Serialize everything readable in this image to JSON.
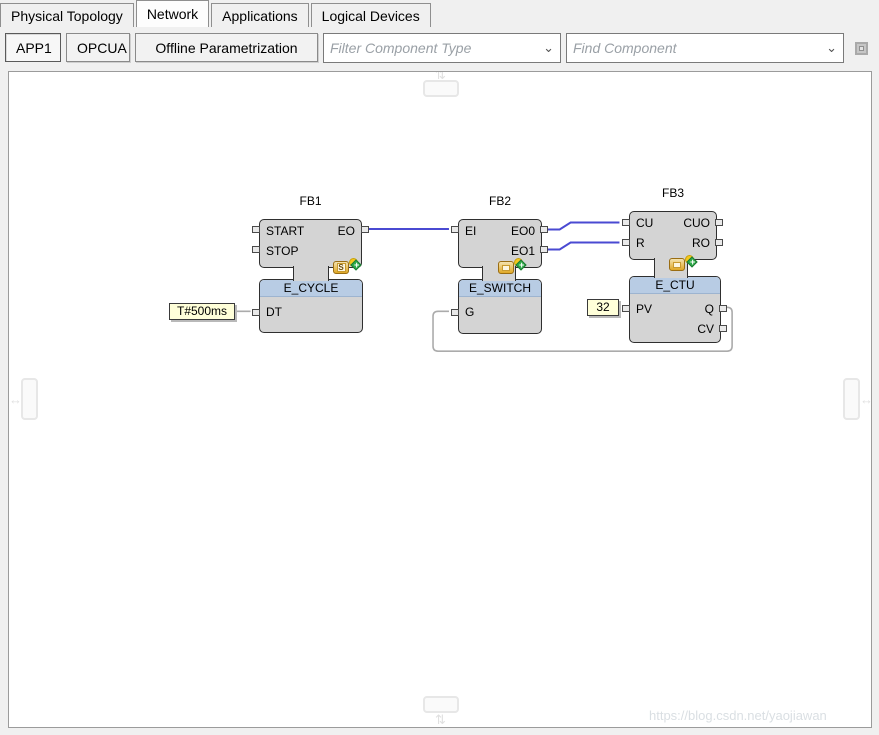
{
  "tabs": [
    {
      "label": "Physical Topology",
      "active": false
    },
    {
      "label": "Network",
      "active": true
    },
    {
      "label": "Applications",
      "active": false
    },
    {
      "label": "Logical Devices",
      "active": false
    }
  ],
  "toolbar": {
    "buttons": [
      {
        "label": "APP1",
        "pressed": true
      },
      {
        "label": "OPCUA",
        "pressed": false
      },
      {
        "label": "Offline Parametrization",
        "pressed": false
      }
    ],
    "filter_combo": {
      "placeholder": "Filter Component Type"
    },
    "find_combo": {
      "placeholder": "Find Component"
    }
  },
  "diagram": {
    "blocks": [
      {
        "name": "FB1",
        "type": "E_CYCLE",
        "kind_icon": "sifb-s-chip-icon",
        "event_inputs": [
          "START",
          "STOP"
        ],
        "event_outputs": [
          "EO"
        ],
        "data_inputs": [
          {
            "name": "DT",
            "value": "T#500ms"
          }
        ],
        "data_outputs": []
      },
      {
        "name": "FB2",
        "type": "E_SWITCH",
        "kind_icon": "fb-chip-icon",
        "event_inputs": [
          "EI"
        ],
        "event_outputs": [
          "EO0",
          "EO1"
        ],
        "data_inputs": [
          {
            "name": "G",
            "value": ""
          }
        ],
        "data_outputs": []
      },
      {
        "name": "FB3",
        "type": "E_CTU",
        "kind_icon": "fb-chip-icon",
        "event_inputs": [
          "CU",
          "R"
        ],
        "event_outputs": [
          "CUO",
          "RO"
        ],
        "data_inputs": [
          {
            "name": "PV",
            "value": "32"
          }
        ],
        "data_outputs": [
          "Q",
          "CV"
        ]
      }
    ],
    "connections": [
      {
        "from": "FB1.EO",
        "to": "FB2.EI",
        "kind": "event"
      },
      {
        "from": "FB2.EO0",
        "to": "FB3.CU",
        "kind": "event"
      },
      {
        "from": "FB2.EO1",
        "to": "FB3.R",
        "kind": "event"
      },
      {
        "from": "FB3.Q",
        "to": "FB2.G",
        "kind": "data"
      }
    ],
    "colors": {
      "event_wire": "#4a4ad2",
      "data_wire": "#ababab",
      "block_fill": "#d4d4d4",
      "block_border": "#2f2f2f",
      "type_band": "#b8cce4",
      "value_fill": "#ffffd9"
    }
  },
  "watermark": "https://blog.csdn.net/yaojiawan"
}
